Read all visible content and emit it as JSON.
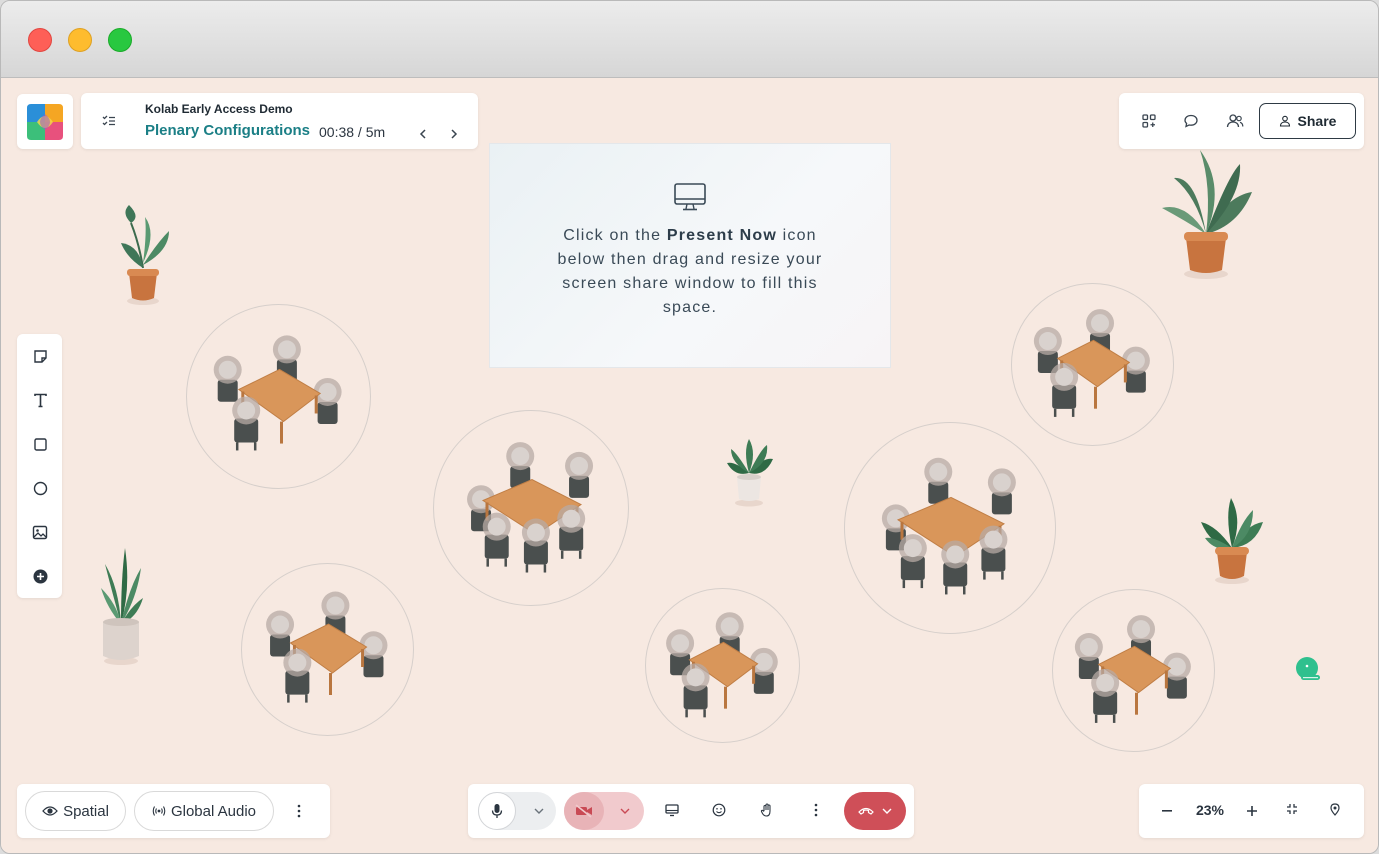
{
  "agenda": {
    "org_name": "Kolab Early Access Demo",
    "session_name": "Plenary Configurations",
    "timer": "00:38 / 5m"
  },
  "top_right": {
    "share_label": "Share",
    "icons": [
      "apps-icon",
      "chat-icon",
      "participants-icon",
      "user-icon"
    ]
  },
  "screen_share": {
    "message_prefix": "Click on the ",
    "message_strong": "Present Now",
    "message_suffix": " icon below then drag and resize your screen share window to fill this space."
  },
  "tools": [
    "sticky-note-icon",
    "text-icon",
    "rectangle-icon",
    "circle-icon",
    "image-icon",
    "add-icon"
  ],
  "bottom_left": {
    "spatial_label": "Spatial",
    "global_audio_label": "Global Audio"
  },
  "bottom_right": {
    "zoom_level": "23%"
  },
  "colors": {
    "canvas_bg": "#f7e9e1",
    "accent_teal": "#1b7f86",
    "leave_red": "#cf4f58",
    "camera_off_pink": "#f1cacd",
    "table_wood": "#d9965a",
    "chair_dark": "#4a4f4e"
  }
}
